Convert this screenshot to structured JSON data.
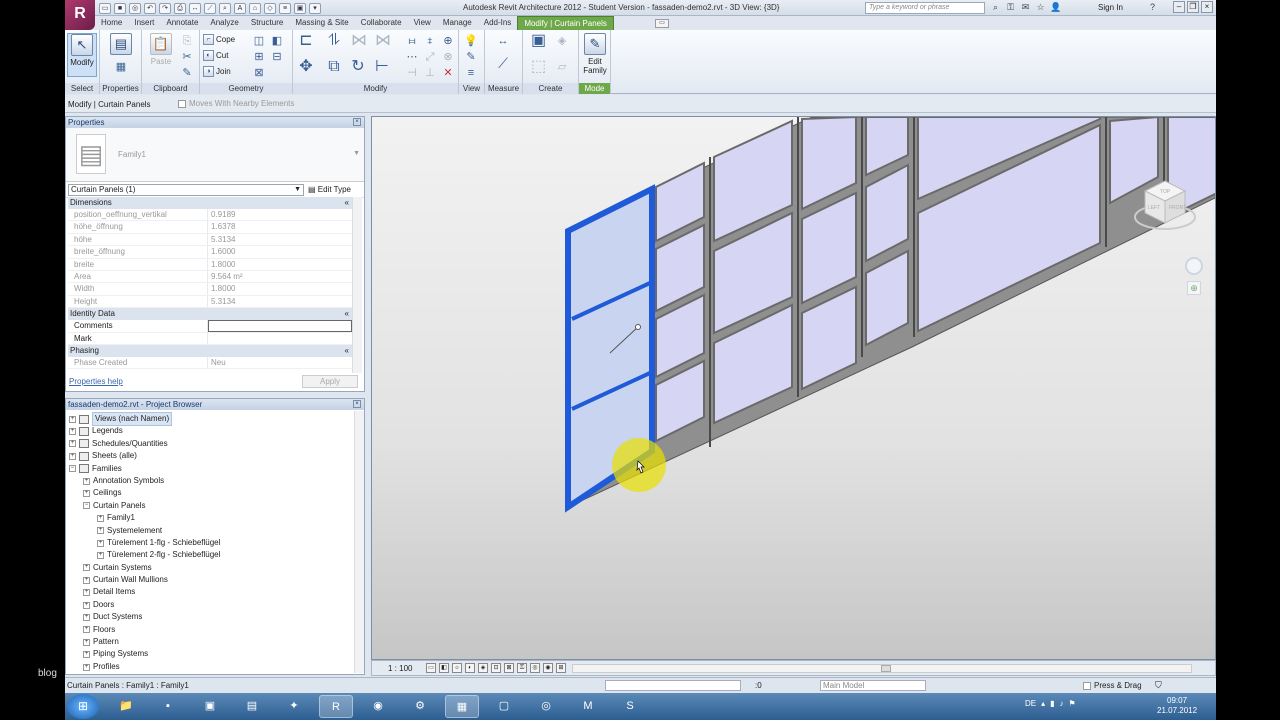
{
  "window": {
    "title": "Autodesk Revit Architecture 2012 - Student Version -    fassaden-demo2.rvt - 3D View: {3D}",
    "search_placeholder": "Type a keyword or phrase",
    "sign_in": "Sign In",
    "help": "?",
    "logo": "R"
  },
  "tabs": [
    {
      "label": "Home"
    },
    {
      "label": "Insert"
    },
    {
      "label": "Annotate"
    },
    {
      "label": "Analyze"
    },
    {
      "label": "Structure"
    },
    {
      "label": "Massing & Site"
    },
    {
      "label": "Collaborate"
    },
    {
      "label": "View"
    },
    {
      "label": "Manage"
    },
    {
      "label": "Add-Ins"
    },
    {
      "label": "Modify | Curtain Panels"
    }
  ],
  "ribbon": {
    "modify_label": "Modify",
    "paste_label": "Paste",
    "cope": "Cope",
    "cut": "Cut",
    "join": "Join",
    "edit_family_line1": "Edit",
    "edit_family_line2": "Family",
    "panels": {
      "select": "Select",
      "properties": "Properties",
      "clipboard": "Clipboard",
      "geometry": "Geometry",
      "modify": "Modify",
      "view": "View",
      "measure": "Measure",
      "create": "Create",
      "mode": "Mode"
    }
  },
  "options_bar": {
    "context": "Modify | Curtain Panels",
    "moves_with": "Moves With Nearby Elements"
  },
  "properties": {
    "title": "Properties",
    "family": "Family1",
    "instance_selector": "Curtain Panels (1)",
    "edit_type": "Edit Type",
    "groups": [
      {
        "name": "Dimensions",
        "rows": [
          {
            "key": "position_oeffnung_vertikal",
            "value": "0.9189"
          },
          {
            "key": "höhe_öffnung",
            "value": "1.6378"
          },
          {
            "key": "höhe",
            "value": "5.3134"
          },
          {
            "key": "breite_öffnung",
            "value": "1.6000"
          },
          {
            "key": "breite",
            "value": "1.8000"
          },
          {
            "key": "Area",
            "value": "9.564 m²"
          },
          {
            "key": "Width",
            "value": "1.8000"
          },
          {
            "key": "Height",
            "value": "5.3134"
          }
        ]
      },
      {
        "name": "Identity Data",
        "rows": [
          {
            "key": "Comments",
            "value": ""
          },
          {
            "key": "Mark",
            "value": ""
          }
        ]
      },
      {
        "name": "Phasing",
        "rows": [
          {
            "key": "Phase Created",
            "value": "Neu"
          }
        ]
      }
    ],
    "help_link": "Properties help",
    "apply": "Apply"
  },
  "project_browser": {
    "title": "fassaden-demo2.rvt - Project Browser",
    "nodes": [
      {
        "label": "Views (nach Namen)",
        "level": 0,
        "expander": "+",
        "selected": true
      },
      {
        "label": "Legends",
        "level": 0,
        "expander": "+"
      },
      {
        "label": "Schedules/Quantities",
        "level": 0,
        "expander": "+"
      },
      {
        "label": "Sheets (alle)",
        "level": 0,
        "expander": "+"
      },
      {
        "label": "Families",
        "level": 0,
        "expander": "−"
      },
      {
        "label": "Annotation Symbols",
        "level": 1,
        "expander": "+"
      },
      {
        "label": "Ceilings",
        "level": 1,
        "expander": "+"
      },
      {
        "label": "Curtain Panels",
        "level": 1,
        "expander": "−"
      },
      {
        "label": "Family1",
        "level": 2,
        "expander": "+"
      },
      {
        "label": "Systemelement",
        "level": 2,
        "expander": "+"
      },
      {
        "label": "Türelement 1-flg - Schiebeflügel",
        "level": 2,
        "expander": "+"
      },
      {
        "label": "Türelement 2-flg - Schiebeflügel",
        "level": 2,
        "expander": "+"
      },
      {
        "label": "Curtain Systems",
        "level": 1,
        "expander": "+"
      },
      {
        "label": "Curtain Wall Mullions",
        "level": 1,
        "expander": "+"
      },
      {
        "label": "Detail Items",
        "level": 1,
        "expander": "+"
      },
      {
        "label": "Doors",
        "level": 1,
        "expander": "+"
      },
      {
        "label": "Duct Systems",
        "level": 1,
        "expander": "+"
      },
      {
        "label": "Floors",
        "level": 1,
        "expander": "+"
      },
      {
        "label": "Pattern",
        "level": 1,
        "expander": "+"
      },
      {
        "label": "Piping Systems",
        "level": 1,
        "expander": "+"
      },
      {
        "label": "Profiles",
        "level": 1,
        "expander": "+"
      }
    ]
  },
  "view": {
    "scale": "1 : 100",
    "viewcube_top": "TOP",
    "viewcube_left": "LEFT",
    "viewcube_front": "FRONT"
  },
  "status_bar": {
    "text": "Curtain Panels : Family1 : Family1",
    "selection_count": ":0",
    "model": "Main Model",
    "press_drag": "Press & Drag"
  },
  "taskbar": {
    "lang": "DE",
    "time": "09:07",
    "date": "21.07.2012"
  },
  "overlay": {
    "blog": "blog"
  },
  "colors": {
    "accent": "#6ea84b",
    "selected_panel": "#1f5ad8",
    "glass": "#d6d6f4",
    "highlight": "#e8e000"
  }
}
